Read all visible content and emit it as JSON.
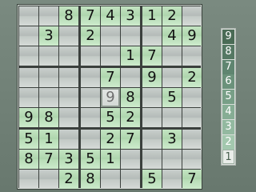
{
  "board": {
    "givens": [
      [
        "",
        "",
        "8",
        "7",
        "4",
        "3",
        "1",
        "2",
        ""
      ],
      [
        "",
        "3",
        "",
        "2",
        "",
        "",
        "",
        "4",
        "9"
      ],
      [
        "",
        "",
        "",
        "",
        "",
        "1",
        "7",
        "",
        ""
      ],
      [
        "",
        "",
        "",
        "",
        "7",
        "",
        "9",
        "",
        "2"
      ],
      [
        "",
        "",
        "",
        "",
        "",
        "8",
        "",
        "5",
        ""
      ],
      [
        "9",
        "8",
        "",
        "",
        "5",
        "2",
        "",
        "",
        ""
      ],
      [
        "5",
        "1",
        "",
        "",
        "2",
        "7",
        "",
        "3",
        ""
      ],
      [
        "8",
        "7",
        "3",
        "5",
        "1",
        "",
        "",
        "",
        ""
      ],
      [
        "",
        "",
        "2",
        "8",
        "",
        "",
        "5",
        "",
        "7"
      ]
    ],
    "selected": {
      "row": 4,
      "col": 4,
      "value": "9"
    }
  },
  "picker": {
    "numbers": [
      "9",
      "8",
      "7",
      "6",
      "5",
      "4",
      "3",
      "2",
      "1"
    ],
    "active": "1",
    "colors": {
      "9": "#4a6b55",
      "8": "#557863",
      "7": "#5f8570",
      "6": "#6b927b",
      "5": "#789f87",
      "4": "#86ad94",
      "3": "#93b9a0",
      "2": "#a3c8ae",
      "1": "#e9ede9"
    }
  },
  "colors": {
    "given_cell": "#b7dcb6",
    "empty_cell": "#bfc6c2",
    "grid_line": "#3b403d",
    "background": "#6e7d74"
  }
}
